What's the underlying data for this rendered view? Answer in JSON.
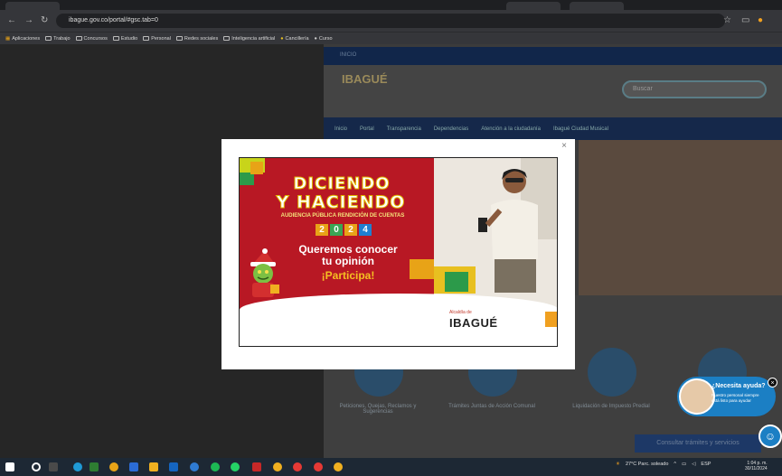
{
  "browser": {
    "url": "ibague.gov.co/portal/#gsc.tab=0",
    "bookmarks": [
      "Aplicaciones",
      "Trabajo",
      "Concursos",
      "Estudio",
      "Personal",
      "Redes sociales",
      "Inteligencia artificial",
      "Cancillería",
      "Curso"
    ]
  },
  "site": {
    "top_label": "INICIO",
    "logo": "IBAGUÉ",
    "search_placeholder": "Buscar",
    "nav": [
      "Inicio",
      "Portal",
      "Transparencia",
      "Dependencias",
      "Atención a la ciudadanía",
      "Ibagué Ciudad Musical"
    ],
    "cards": [
      "Peticiones, Quejas, Reclamos y Sugerencias",
      "Trámites Juntas de Acción Comunal",
      "Liquidación de Impuesto Predial"
    ],
    "cta": "Consultar trámites y servicios"
  },
  "modal": {
    "close": "×",
    "title_line1": "DICIENDO",
    "title_line2": "Y HACIENDO",
    "subtitle": "AUDIENCIA PÚBLICA RENDICIÓN DE CUENTAS",
    "year_digits": [
      "2",
      "0",
      "2",
      "4"
    ],
    "year_colors": [
      "#e8a317",
      "#3aa655",
      "#e8a317",
      "#1f7fd0"
    ],
    "message": "Queremos conocer tu opinión",
    "cta": "¡Participa!",
    "logo_prefix": "Alcaldía de",
    "logo_name": "IBAGUÉ"
  },
  "chat": {
    "title": "¿Necesita ayuda?",
    "body": "Nuestro personal siempre está listo para ayudar",
    "close": "×"
  },
  "taskbar": {
    "weather": "27°C  Parc. soleado",
    "lang": "ESP",
    "time": "1:04 p. m.",
    "date": "30/11/2024"
  }
}
